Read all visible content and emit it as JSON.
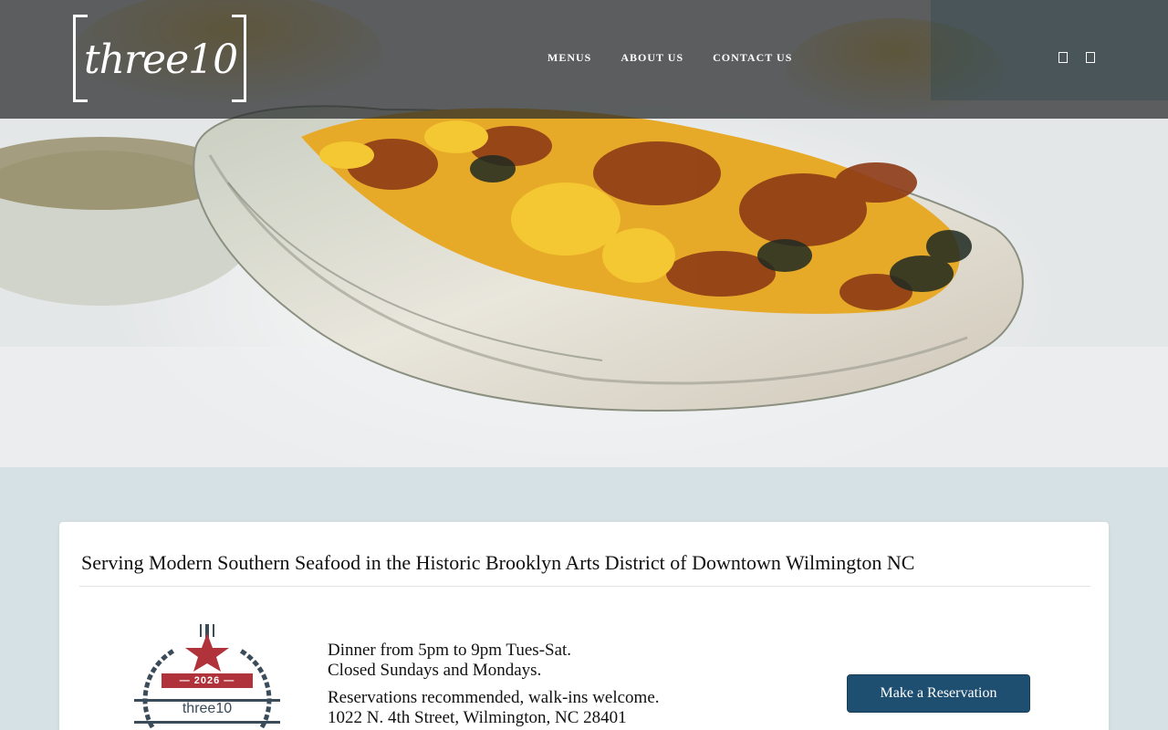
{
  "brand": {
    "logo_text": "three10"
  },
  "nav": {
    "items": [
      {
        "label": "MENUS"
      },
      {
        "label": "ABOUT US"
      },
      {
        "label": "CONTACT US"
      }
    ],
    "social_icons": [
      "facebook-icon",
      "instagram-icon"
    ]
  },
  "hero": {
    "image": "roasted-oyster-photo"
  },
  "main": {
    "headline": "Serving Modern Southern Seafood in the Historic Brooklyn Arts District of Downtown Wilmington NC",
    "badge": {
      "year": "— 2026 —",
      "name": "three10"
    },
    "hours_line1": "Dinner from 5pm to 9pm Tues-Sat.",
    "hours_line2": "Closed Sundays and Mondays.",
    "reservations_line": "Reservations recommended, walk-ins welcome.",
    "address_line": "1022 N. 4th Street, Wilmington, NC 28401",
    "reserve_button": "Make a Reservation"
  },
  "colors": {
    "header_overlay": "#26282a",
    "page_background": "#d6e1e5",
    "button": "#1f4f70",
    "badge_red": "#b0323a",
    "badge_navy": "#3a4c5a"
  }
}
